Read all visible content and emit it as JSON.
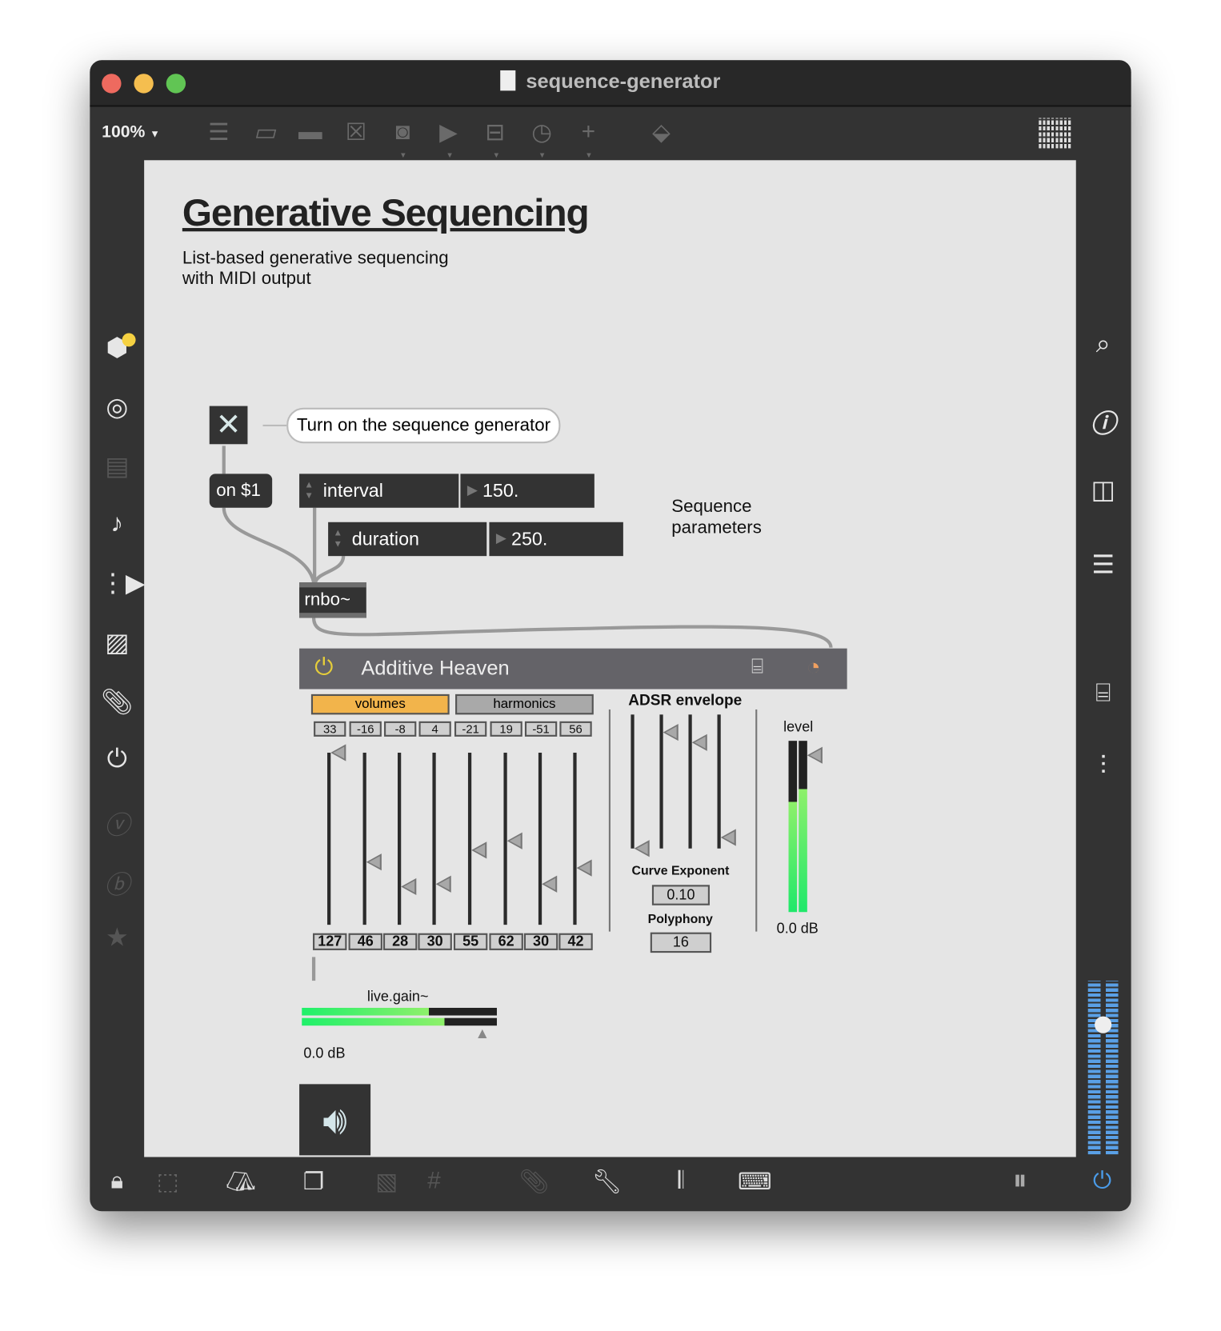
{
  "window": {
    "title": "sequence-generator",
    "zoom": "100%",
    "traffic_colors": [
      "#ee6a5f",
      "#f5be4f",
      "#61c554"
    ]
  },
  "toolbar": {
    "icons": [
      "object-box-icon",
      "message-icon",
      "comment-icon",
      "toggle-icon",
      "button-icon",
      "play-icon",
      "slider-icon",
      "dial-icon",
      "plus-icon",
      "paint-bucket-icon"
    ],
    "grid_icon": "grid-icon"
  },
  "left_sidebar": {
    "icons": [
      "package-icon",
      "target-icon",
      "media-icon",
      "music-note-icon",
      "sequencer-icon",
      "image-icon",
      "paperclip-icon",
      "plug-icon",
      "vimeo-icon",
      "b-icon",
      "star-icon"
    ]
  },
  "right_sidebar": {
    "icons": [
      "search-icon",
      "info-icon",
      "columns-icon",
      "list-icon",
      "camera-icon",
      "mixer-icon"
    ],
    "meter_accent": "#5aa0e6"
  },
  "bottom_toolbar": {
    "icons": [
      "lock-icon",
      "presentation-select-icon",
      "easel-icon",
      "windows-icon",
      "mute-icon",
      "grid-icon",
      "attach-icon",
      "wrench-icon",
      "piano-icon",
      "keyboard-icon",
      "audio-pause-icon",
      "power-icon"
    ],
    "power_color": "#4a9be8"
  },
  "patch": {
    "title": "Generative Sequencing",
    "subtitle_line1": "List-based generative sequencing",
    "subtitle_line2": "with MIDI output",
    "toggle_comment": "Turn on the sequence generator",
    "message": "on $1",
    "interval": {
      "label": "interval",
      "value": "150."
    },
    "duration": {
      "label": "duration",
      "value": "250."
    },
    "params_comment_line1": "Sequence",
    "params_comment_line2": "parameters",
    "rnbo": "rnbo~",
    "live_gain_label": "live.gain~",
    "live_gain_value": "0.0 dB"
  },
  "device": {
    "name": "Additive Heaven",
    "accent": "#f2b44b",
    "tabs": [
      {
        "label": "volumes",
        "active": true
      },
      {
        "label": "harmonics",
        "active": false
      }
    ],
    "harmonics": [
      "33",
      "-16",
      "-8",
      "4",
      "-21",
      "19",
      "-51",
      "56"
    ],
    "volumes": [
      "127",
      "46",
      "28",
      "30",
      "55",
      "62",
      "30",
      "42"
    ],
    "volume_max": 127,
    "adsr_label": "ADSR envelope",
    "adsr_levels": [
      0.0,
      0.87,
      0.79,
      0.08
    ],
    "curve_label": "Curve Exponent",
    "curve_value": "0.10",
    "polyphony_label": "Polyphony",
    "polyphony_value": "16",
    "level_label": "level",
    "level_value": "0.0 dB"
  }
}
